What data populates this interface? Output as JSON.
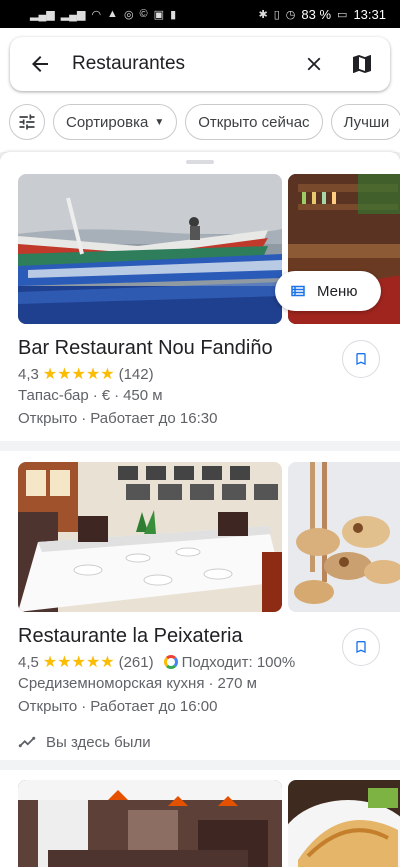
{
  "status_bar": {
    "battery": "83 %",
    "time": "13:31"
  },
  "search": {
    "query": "Restaurantes"
  },
  "chips": {
    "sort_label": "Сортировка",
    "open_now_label": "Открыто сейчас",
    "best_label": "Лучши"
  },
  "menu_label": "Меню",
  "places": [
    {
      "name": "Bar Restaurant Nou Fandiño",
      "rating": "4,3",
      "reviews": "(142)",
      "category": "Тапас-бар",
      "price": "€",
      "distance": "450 м",
      "status": "Открыто",
      "hours": "Работает до 16:30"
    },
    {
      "name": "Restaurante la Peixateria",
      "rating": "4,5",
      "reviews": "(261)",
      "match": "Подходит: 100%",
      "category": "Средиземноморская кухня",
      "distance": "270 м",
      "status": "Открыто",
      "hours": "Работает до 16:00",
      "visited": "Вы здесь были"
    }
  ],
  "colors": {
    "accent_blue": "#1a73e8",
    "star_yellow": "#fbbc04"
  }
}
